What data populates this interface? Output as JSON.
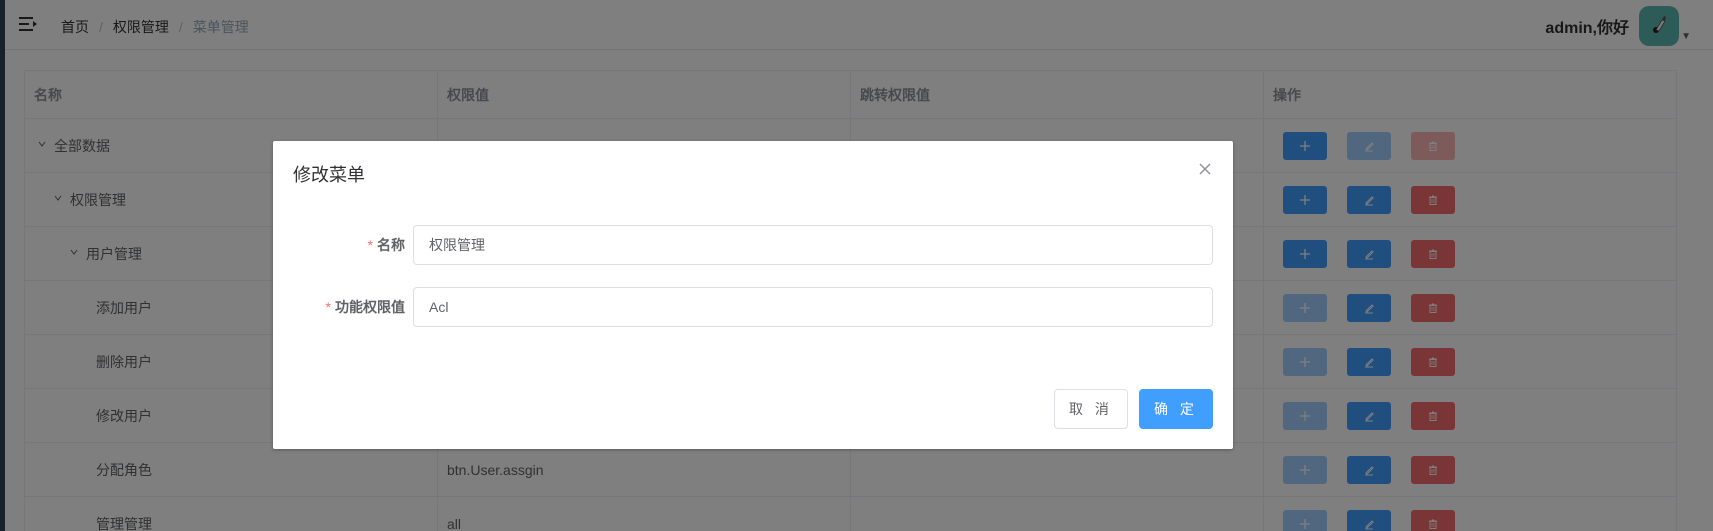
{
  "navbar": {
    "breadcrumb": [
      "首页",
      "权限管理",
      "菜单管理"
    ],
    "breadcrumb_sep": "/",
    "user_name": "admin,你好"
  },
  "table": {
    "columns": [
      "名称",
      "权限值",
      "跳转权限值",
      "操作"
    ],
    "rows": [
      {
        "name": "全部数据",
        "value": "",
        "jump": "",
        "expanded": true,
        "level": 0,
        "add_disabled": false,
        "edit_disabled": true,
        "del_disabled": true
      },
      {
        "name": "权限管理",
        "value": "",
        "jump": "",
        "expanded": true,
        "level": 1,
        "add_disabled": false,
        "edit_disabled": false,
        "del_disabled": false
      },
      {
        "name": "用户管理",
        "value": "",
        "jump": "",
        "expanded": true,
        "level": 2,
        "add_disabled": false,
        "edit_disabled": false,
        "del_disabled": false
      },
      {
        "name": "添加用户",
        "value": "",
        "jump": "",
        "level": 3,
        "add_disabled": true,
        "edit_disabled": false,
        "del_disabled": false
      },
      {
        "name": "删除用户",
        "value": "",
        "jump": "",
        "level": 3,
        "add_disabled": true,
        "edit_disabled": false,
        "del_disabled": false
      },
      {
        "name": "修改用户",
        "value": "",
        "jump": "",
        "level": 3,
        "add_disabled": true,
        "edit_disabled": false,
        "del_disabled": false
      },
      {
        "name": "分配角色",
        "value": "btn.User.assgin",
        "jump": "",
        "level": 3,
        "add_disabled": true,
        "edit_disabled": false,
        "del_disabled": false
      },
      {
        "name": "管理管理",
        "value": "all",
        "jump": "",
        "level": 3,
        "add_disabled": true,
        "edit_disabled": false,
        "del_disabled": false
      }
    ]
  },
  "dialog": {
    "title": "修改菜单",
    "required_mark": "*",
    "fields": [
      {
        "label": "名称",
        "value": "权限管理"
      },
      {
        "label": "功能权限值",
        "value": "Acl"
      }
    ],
    "cancel_label": "取 消",
    "ok_label": "确 定"
  },
  "colors": {
    "primary": "#409eff",
    "danger": "#f56c6c",
    "sidebar": "#304156",
    "avatar_bg": "#5ab9b0"
  }
}
